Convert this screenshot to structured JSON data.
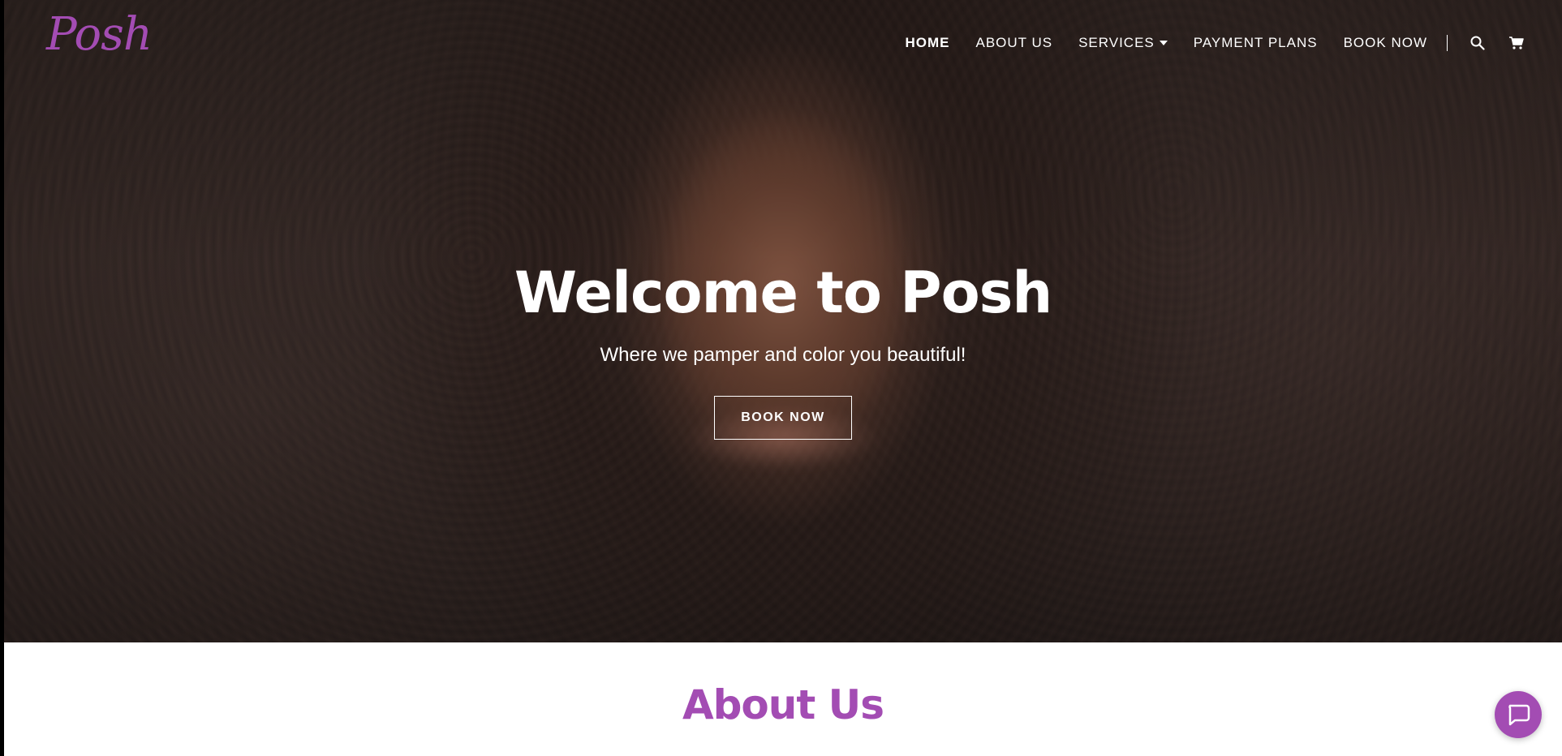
{
  "brand": {
    "logo_text": "Posh",
    "accent_color": "#a34cb3"
  },
  "nav": {
    "items": [
      {
        "label": "HOME",
        "active": true
      },
      {
        "label": "ABOUT US",
        "active": false
      },
      {
        "label": "SERVICES",
        "active": false,
        "has_dropdown": true
      },
      {
        "label": "PAYMENT PLANS",
        "active": false
      },
      {
        "label": "BOOK NOW",
        "active": false
      }
    ],
    "icons": [
      "search-icon",
      "cart-icon"
    ]
  },
  "hero": {
    "title": "Welcome to Posh",
    "subtitle": "Where we pamper and color you beautiful!",
    "button_label": "BOOK NOW"
  },
  "about": {
    "title": "About Us"
  },
  "chat": {
    "icon": "chat-bubble-icon"
  }
}
